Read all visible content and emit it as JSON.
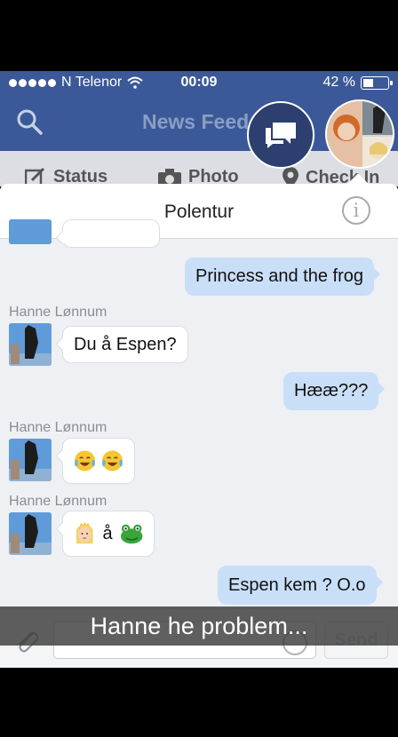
{
  "status_bar": {
    "carrier": "N Telenor",
    "time": "00:09",
    "battery_text": "42 %",
    "battery_level": 0.42
  },
  "header": {
    "title": "News Feed"
  },
  "compose_bar": {
    "status_label": "Status",
    "photo_label": "Photo",
    "checkin_label": "Check In"
  },
  "conversation": {
    "title": "Polentur",
    "messages": [
      {
        "direction": "out",
        "text": "Princess and the frog"
      },
      {
        "direction": "in",
        "sender": "Hanne Lønnum",
        "text": "Du å Espen?"
      },
      {
        "direction": "out",
        "text": "Hææ???"
      },
      {
        "direction": "in",
        "sender": "Hanne Lønnum",
        "text": ""
      },
      {
        "direction": "in",
        "sender": "Hanne Lønnum",
        "text": "å"
      },
      {
        "direction": "out",
        "text": "Espen kem ? O.o"
      }
    ]
  },
  "composer": {
    "send_label": "Send"
  },
  "overlay": {
    "caption": "Hanne he problem..."
  },
  "colors": {
    "facebook_blue": "#3b5998",
    "outgoing_bubble": "#c9dff8"
  }
}
